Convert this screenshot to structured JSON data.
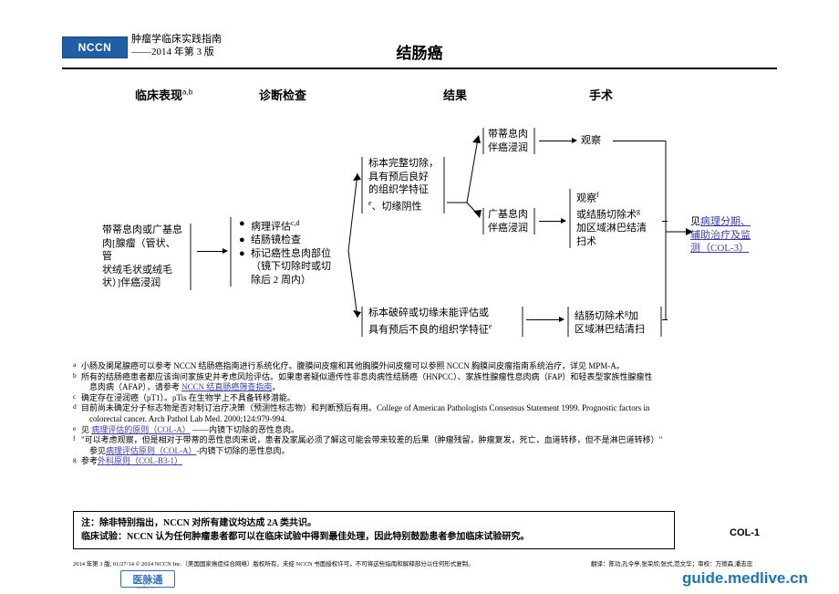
{
  "header": {
    "logo": "NCCN",
    "subtitle_line1": "肿瘤学临床实践指南",
    "subtitle_line2": "——2014 年第 3 版",
    "title": "结肠癌"
  },
  "columns": [
    {
      "label": "临床表现",
      "sup": "a,b"
    },
    {
      "label": "诊断检查",
      "sup": ""
    },
    {
      "label": "结果",
      "sup": ""
    },
    {
      "label": "手术",
      "sup": ""
    }
  ],
  "nodes": {
    "clinical": "带蒂息肉或广基息\n肉[腺瘤（管状、管\n状绒毛状或绒毛\n状）]伴癌浸润",
    "workup": [
      {
        "text": "病理评估",
        "sup": "c,d"
      },
      {
        "text": "结肠镜检查",
        "sup": ""
      },
      {
        "text": "标记癌性息肉部位\n（镜下切除时或切\n除后 2 周内）",
        "sup": ""
      }
    ],
    "finding_good_1": "标本完整切除，\n具有预后良好\n的组织学特征",
    "finding_good_1_sup": "e",
    "finding_good_2": "、切缘阴性",
    "finding_bad": "标本破碎或切缘未能评估或\n具有预后不良的组织学特征",
    "finding_bad_sup": "e",
    "pedunculated": "带蒂息肉\n伴癌浸润",
    "sessile": "广基息肉\n伴癌浸润",
    "observe": "观察",
    "observe_or_colectomy_line1": "观察",
    "observe_or_colectomy_line1_sup": "f",
    "observe_or_colectomy_line2": "或结肠切除术",
    "observe_or_colectomy_line2_sup": "g",
    "observe_or_colectomy_line3": "加区域淋巴结清\n扫术",
    "colectomy": "结肠切除术",
    "colectomy_sup": "g",
    "colectomy_tail": "加\n区域淋巴结清扫",
    "outcome_link_prefix": "见",
    "outcome_link": "病理分期、\n辅助治疗及监\n测（COL-3）"
  },
  "footnotes": [
    {
      "mark": "a",
      "text": "小肠及阑尾腺癌可以参考 NCCN 结肠癌指南进行系统化疗。腹膜间皮瘤和其他胸膜外间皮瘤可以参照 NCCN 胸膜间皮瘤指南系统治疗，详见 MPM-A。"
    },
    {
      "mark": "b",
      "text": "所有的结肠癌患者都应该询问家族史并考虑风险评估。如果患者疑似遗传性非息肉病性结肠癌（HNPCC）、家族性腺瘤性息肉病（FAP）和轻表型家族性腺瘤性",
      "indent": "息肉病（AFAP），请参考 ",
      "link": "NCCN 结直肠癌筛查指南",
      "indent_tail": "。"
    },
    {
      "mark": "c",
      "text": "确定存在浸润癌（pT1）。pTis 在生物学上不具备转移潜能。"
    },
    {
      "mark": "d",
      "text": "目前尚未确定分子标志物是否对制订治疗决策（预测性标志物）和判断预后有用。College of American Pathologists Consensus Statement 1999. Prognostic factors in",
      "indent": "colorectal cancer. Arch Pathol Lab Med. 2000;124:979-994."
    },
    {
      "mark": "e",
      "text_prefix": "见 ",
      "link": "病理评估的原则（COL-A）",
      "text_suffix": " ——内镜下切除的恶性息肉。"
    },
    {
      "mark": "f",
      "text": "\"可以考虑观察，但是相对于带蒂的恶性息肉来说，患者及家属必须了解这可能会带来较差的后果（肿瘤残留，肿瘤复发，死亡，血道转移，但不是淋巴道转移）\"",
      "indent_prefix": "参见",
      "link": "病理评估原则（COL-A）",
      "indent_suffix": "-内镜下切除的恶性息肉。"
    },
    {
      "mark": "g",
      "text_prefix": "参考",
      "link": "外科原则（COL-B3-1）"
    }
  ],
  "notebox": {
    "line1": "注：除非特别指出，NCCN 对所有建议均达成 2A 类共识。",
    "line2": "临床试验：NCCN 认为任何肿瘤患者都可以在临床试验中得到最佳处理，因此特别鼓励患者参加临床试验研究。"
  },
  "page_code": "COL-1",
  "footer": {
    "left": "2014 年第 3 版, 01/27/14 © 2014 NCCN Inc.（美国国家癌症综合网络）版权所有。未经 NCCN 书面授权许可，不可将这些指南和解释部分以任何形式复制。",
    "right_line1": "翻译：陈功,孔令亭,张荣欣;张式,范文华；审校：万德森,潘志忠",
    "medlive_logo": "医脉通",
    "medlive_sub": "medlive.cn",
    "url": "guide.medlive.cn"
  },
  "colors": {
    "brand_blue": "#1f5fa6",
    "link_blue": "#3b3bb5",
    "url_blue": "#1b72c4",
    "bar_gray": "#8a8a8a"
  }
}
